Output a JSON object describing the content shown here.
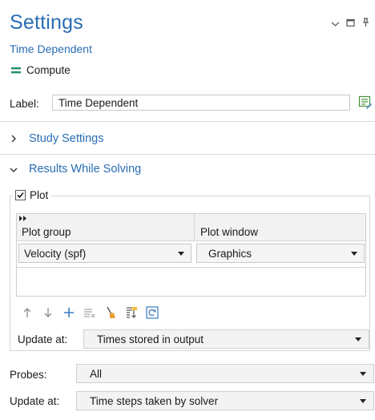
{
  "header": {
    "title": "Settings",
    "subtitle": "Time Dependent",
    "compute_label": "Compute",
    "accent_color": "#2a6db5",
    "compute_icon_color": "#1f8f63"
  },
  "window_controls": {
    "minimize_symbol": "⌄",
    "restore_symbol": "□",
    "pin_symbol": "ꟼ"
  },
  "label_field": {
    "label": "Label:",
    "value": "Time Dependent"
  },
  "sections": {
    "study_settings": {
      "title": "Study Settings",
      "expanded": false
    },
    "results_while_solving": {
      "title": "Results While Solving",
      "expanded": true
    }
  },
  "plot": {
    "label": "Plot",
    "checked": true,
    "table": {
      "headers": [
        "Plot group",
        "Plot window"
      ],
      "rows": [
        {
          "plot_group": "Velocity (spf)",
          "plot_window": "Graphics"
        }
      ]
    },
    "toolbar_icons": [
      "move-up-icon",
      "move-down-icon",
      "add-icon",
      "delete-icon",
      "clear-icon",
      "load-from-file-icon",
      "refresh-icon"
    ],
    "update_at": {
      "label": "Update at:",
      "value": "Times stored in output"
    }
  },
  "probes": {
    "label": "Probes:",
    "value": "All"
  },
  "probe_update": {
    "label": "Update at:",
    "value": "Time steps taken by solver"
  }
}
